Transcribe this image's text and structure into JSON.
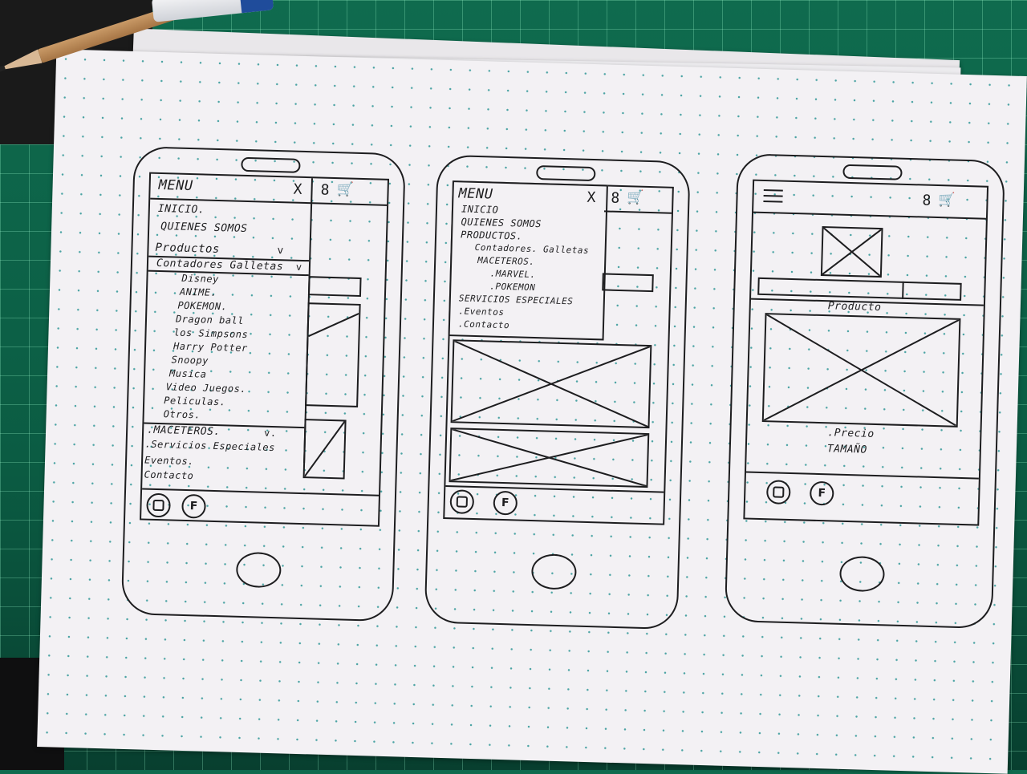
{
  "phone1": {
    "menu_title": "MENU",
    "close": "X",
    "user": "8",
    "cart": "🛒",
    "items": [
      "INICIO.",
      "QUIENES SOMOS",
      "Productos"
    ],
    "productos_chevron": "v",
    "subitem": "Contadores Galletas",
    "subitem_chevron": "v",
    "subitems": [
      "Disney",
      "ANIME.",
      "POKEMON.",
      "Dragon ball",
      "los Simpsons",
      "Harry Potter",
      "Snoopy",
      "Musica",
      "Video Juegos.",
      "Peliculas.",
      "Otros."
    ],
    "lower_items": [
      ".MACETEROS.",
      ".Servicios Especiales",
      "Eventos.",
      "Contacto"
    ],
    "maceteros_chevron": "v.",
    "social_instagram": "",
    "social_facebook": "F"
  },
  "phone2": {
    "menu_title": "MENU",
    "close": "X",
    "user": "8",
    "cart": "🛒",
    "items": [
      "INICIO",
      "QUIENES SOMOS",
      "PRODUCTOS."
    ],
    "subitems": [
      "Contadores. Galletas",
      "MACETEROS.",
      ".MARVEL.",
      ".POKEMON"
    ],
    "lower_items": [
      "SERVICIOS ESPECIALES",
      ".Eventos",
      ".Contacto"
    ],
    "social_instagram": "",
    "social_facebook": "F"
  },
  "phone3": {
    "user": "8",
    "cart": "🛒",
    "product_label": "Producto",
    "price_label": ".Precio",
    "size_label": "TAMAÑO",
    "social_instagram": "",
    "social_facebook": "F"
  }
}
